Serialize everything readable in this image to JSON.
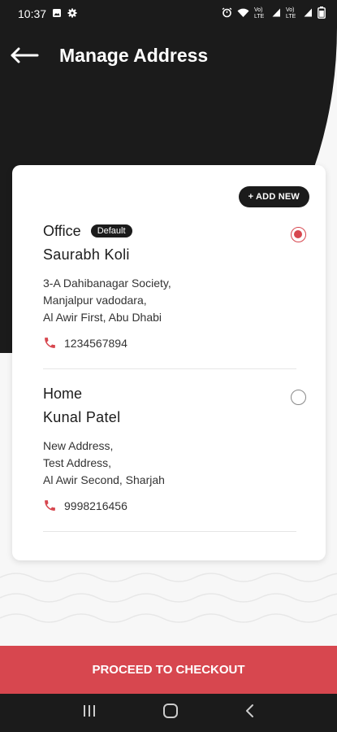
{
  "status_bar": {
    "time": "10:37",
    "signal_text_1": "Vo) LTE",
    "signal_text_2": "Vo) LTE"
  },
  "header": {
    "title": "Manage Address"
  },
  "card": {
    "add_new_label": "+ ADD NEW",
    "addresses": [
      {
        "type": "Office",
        "badge": "Default",
        "name": "Saurabh Koli",
        "line1": "3-A Dahibanagar Society,",
        "line2": "Manjalpur vadodara,",
        "line3": "Al Awir First, Abu Dhabi",
        "phone": "1234567894",
        "selected": true
      },
      {
        "type": "Home",
        "name": "Kunal Patel",
        "line1": "New Address,",
        "line2": "Test Address,",
        "line3": "Al Awir Second, Sharjah",
        "phone": "9998216456",
        "selected": false
      }
    ]
  },
  "footer": {
    "checkout_label": "PROCEED TO CHECKOUT"
  },
  "colors": {
    "accent": "#d7474f",
    "dark": "#1b1b1b"
  }
}
